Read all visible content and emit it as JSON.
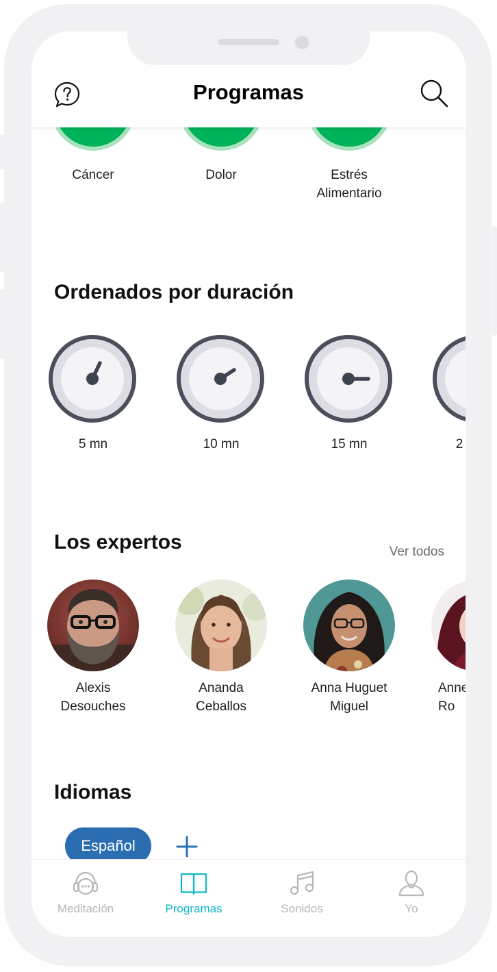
{
  "header": {
    "title": "Programas",
    "help_icon": "question-bubble-icon",
    "search_icon": "magnifier-icon"
  },
  "categories": [
    {
      "label": "Cáncer"
    },
    {
      "label": "Dolor"
    },
    {
      "label": "Estrés\nAlimentario"
    }
  ],
  "duration_section": {
    "title": "Ordenados por duración",
    "items": [
      {
        "label": "5 mn"
      },
      {
        "label": "10 mn"
      },
      {
        "label": "15 mn"
      },
      {
        "label": "2"
      }
    ]
  },
  "experts_section": {
    "title": "Los expertos",
    "see_all": "Ver todos",
    "items": [
      {
        "name": "Alexis\nDesouches"
      },
      {
        "name": "Ananda\nCeballos"
      },
      {
        "name": "Anna Huguet\nMiguel"
      },
      {
        "name": "Anne\nRo"
      }
    ]
  },
  "languages_section": {
    "title": "Idiomas",
    "selected": "Español",
    "add_symbol": "+"
  },
  "tabbar": {
    "items": [
      {
        "label": "Meditación",
        "icon": "headphones-face-icon",
        "active": false
      },
      {
        "label": "Programas",
        "icon": "open-book-icon",
        "active": true
      },
      {
        "label": "Sonidos",
        "icon": "music-note-icon",
        "active": false
      },
      {
        "label": "Yo",
        "icon": "user-icon",
        "active": false
      }
    ]
  },
  "colors": {
    "category_green": "#00b25a",
    "language_pill": "#2a6db0",
    "active_tab": "#13b7c7",
    "inactive_tab": "#b6b6bb",
    "clock_dark": "#4a4f5a"
  }
}
